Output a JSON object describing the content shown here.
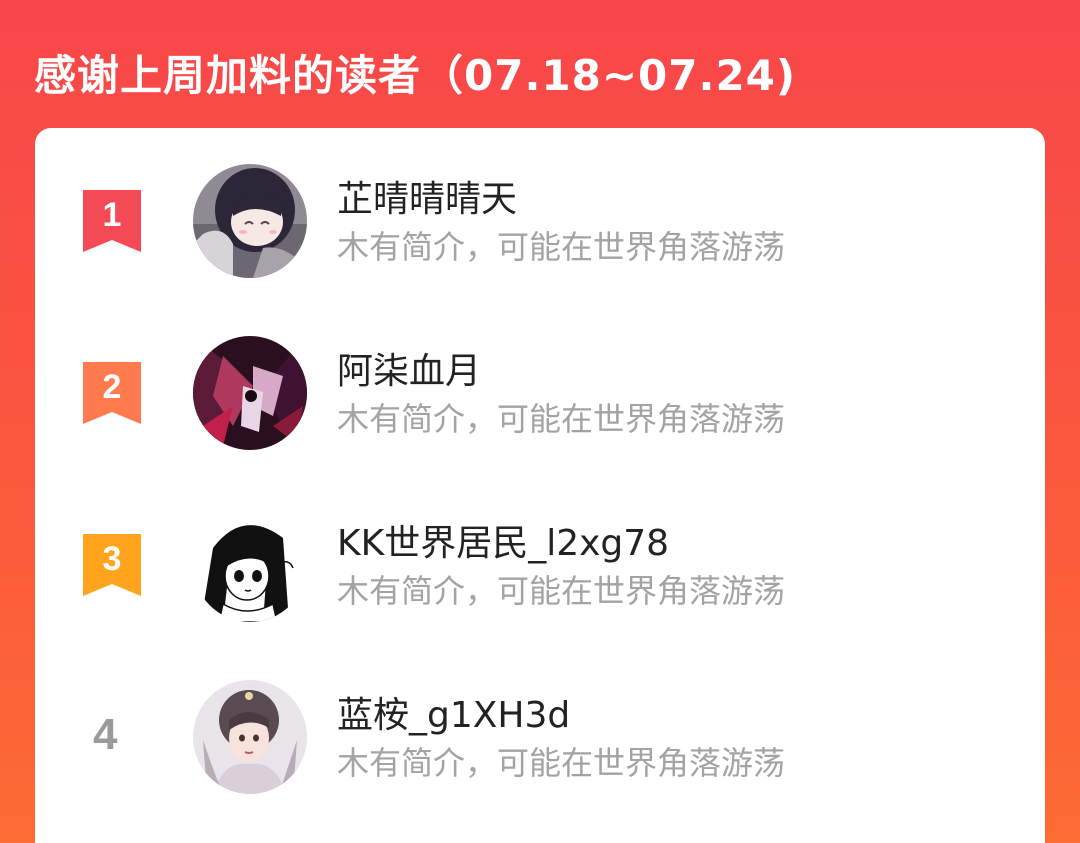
{
  "header": {
    "title": "感谢上周加料的读者（07.18~07.24)"
  },
  "readers": [
    {
      "rank": "1",
      "name": "芷晴晴晴天",
      "bio": "木有简介，可能在世界角落游荡",
      "badge_color": "#f44a55",
      "avatar_icon": "avatar-anime-girl-dark-hair"
    },
    {
      "rank": "2",
      "name": "阿柒血月",
      "bio": "木有简介，可能在世界角落游荡",
      "badge_color": "#ff7a4d",
      "avatar_icon": "avatar-dark-red-fantasy"
    },
    {
      "rank": "3",
      "name": "KK世界居民_l2xg78",
      "bio": "木有简介，可能在世界角落游荡",
      "badge_color": "#ffa41c",
      "avatar_icon": "avatar-manga-girl-sketch"
    },
    {
      "rank": "4",
      "name": "蓝桉_g1XH3d",
      "bio": "木有简介，可能在世界角落游荡",
      "badge_color": "#9a9a9a",
      "avatar_icon": "avatar-ancient-costume-girl"
    }
  ]
}
